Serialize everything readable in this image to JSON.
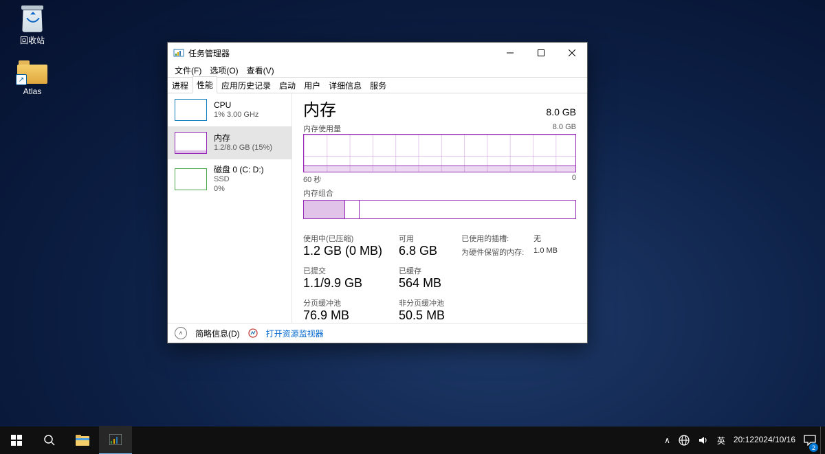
{
  "desktop_icons": {
    "recycle": "回收站",
    "folder": "Atlas",
    "folder_badge": "↗"
  },
  "window": {
    "title": "任务管理器",
    "menu": [
      "文件(F)",
      "选项(O)",
      "查看(V)"
    ],
    "tabs": [
      "进程",
      "性能",
      "应用历史记录",
      "启动",
      "用户",
      "详细信息",
      "服务"
    ],
    "active_tab": 1
  },
  "sidebar": {
    "items": [
      {
        "title": "CPU",
        "sub": "1%  3.00 GHz"
      },
      {
        "title": "内存",
        "sub": "1.2/8.0 GB (15%)"
      },
      {
        "title": "磁盘 0 (C: D:)",
        "sub": "SSD",
        "sub2": "0%"
      }
    ]
  },
  "memory": {
    "heading": "内存",
    "total": "8.0 GB",
    "chart_label": "内存使用量",
    "chart_max": "8.0 GB",
    "axis_left": "60 秒",
    "axis_right": "0",
    "composition_label": "内存组合",
    "stats": {
      "in_use_label": "使用中(已压缩)",
      "in_use_value": "1.2 GB (0 MB)",
      "available_label": "可用",
      "available_value": "6.8 GB",
      "committed_label": "已提交",
      "committed_value": "1.1/9.9 GB",
      "cached_label": "已缓存",
      "cached_value": "564 MB",
      "paged_label": "分页缓冲池",
      "paged_value": "76.9 MB",
      "nonpaged_label": "非分页缓冲池",
      "nonpaged_value": "50.5 MB"
    },
    "right": {
      "slots_label": "已使用的插槽:",
      "slots_value": "无",
      "reserved_label": "为硬件保留的内存:",
      "reserved_value": "1.0 MB"
    }
  },
  "footer": {
    "fewer": "简略信息(D)",
    "resmon": "打开资源监视器"
  },
  "taskbar": {
    "ime": "英",
    "time": "20:12",
    "date": "2024/10/16",
    "notif_count": "2",
    "tray_chevron": "∧"
  },
  "chart_data": {
    "type": "area",
    "title": "内存使用量",
    "xlabel": "60 秒",
    "ylabel": "GB",
    "ylim": [
      0,
      8
    ],
    "x": [
      60,
      55,
      50,
      45,
      40,
      35,
      30,
      25,
      20,
      15,
      10,
      5,
      0
    ],
    "values": [
      1.2,
      1.2,
      1.2,
      1.2,
      1.2,
      1.2,
      1.2,
      1.2,
      1.2,
      1.2,
      1.2,
      1.2,
      1.2
    ]
  }
}
